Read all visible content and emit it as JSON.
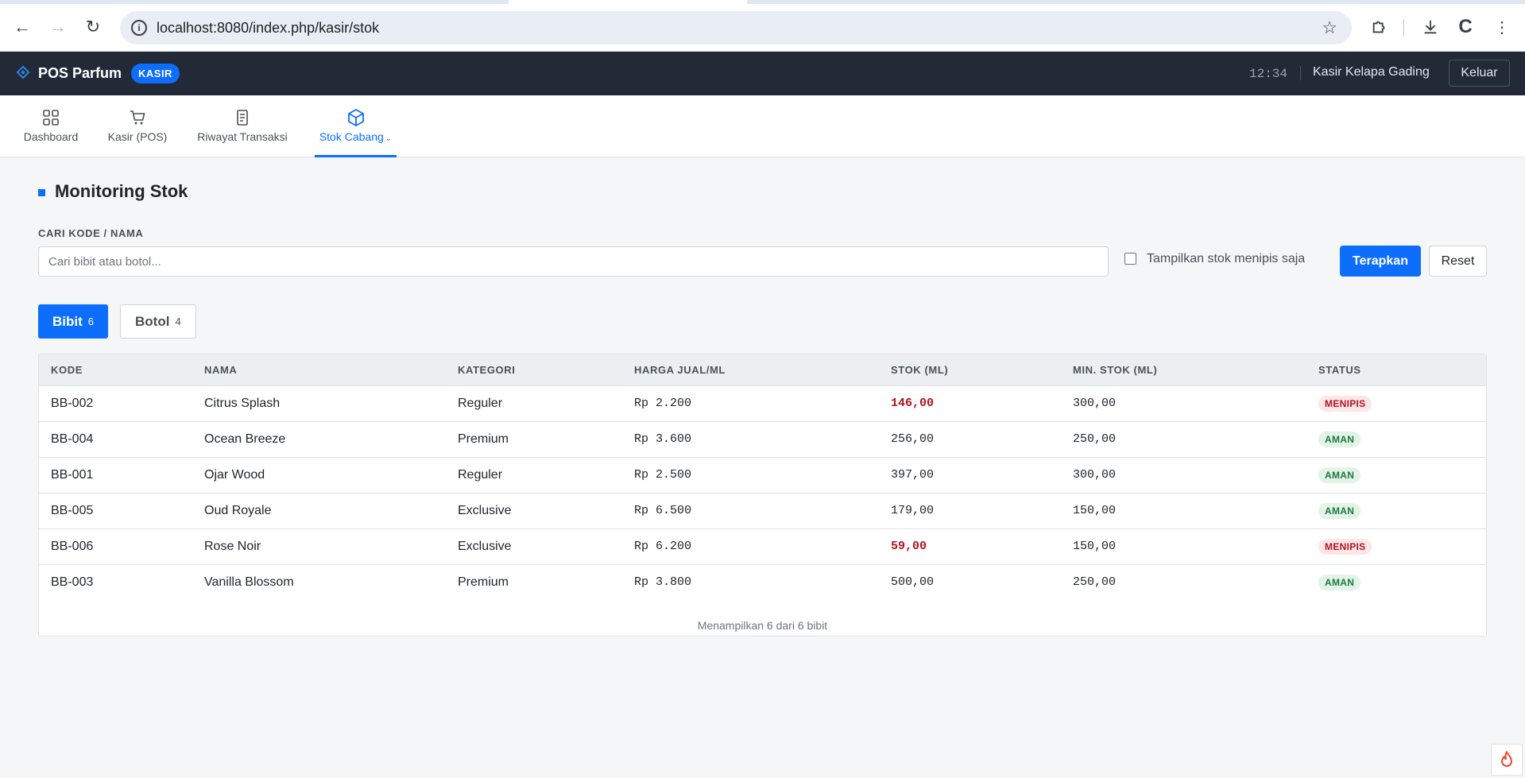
{
  "browser": {
    "url": "localhost:8080/index.php/kasir/stok"
  },
  "header": {
    "brand": "POS Parfum",
    "role_badge": "KASIR",
    "clock": "12:34",
    "user": "Kasir Kelapa Gading",
    "logout_label": "Keluar"
  },
  "nav": {
    "items": [
      {
        "label": "Dashboard",
        "icon": "grid-icon"
      },
      {
        "label": "Kasir (POS)",
        "icon": "cart-icon"
      },
      {
        "label": "Riwayat Transaksi",
        "icon": "receipt-icon"
      },
      {
        "label": "Stok Cabang",
        "icon": "box-icon",
        "active": true
      }
    ]
  },
  "main": {
    "title": "Monitoring Stok",
    "search_label": "CARI KODE / NAMA",
    "search_placeholder": "Cari bibit atau botol...",
    "search_value": "",
    "low_stock_label": "Tampilkan stok menipis saja",
    "low_stock_checked": false,
    "apply_label": "Terapkan",
    "reset_label": "Reset",
    "tabs": [
      {
        "label": "Bibit",
        "count": "6",
        "active": true
      },
      {
        "label": "Botol",
        "count": "4",
        "active": false
      }
    ]
  },
  "table": {
    "columns": [
      "KODE",
      "NAMA",
      "KATEGORI",
      "HARGA JUAL/ML",
      "STOK (ML)",
      "MIN. STOK (ML)",
      "STATUS"
    ],
    "rows": [
      {
        "kode": "BB-002",
        "nama": "Citrus Splash",
        "kategori": "Reguler",
        "harga": "Rp 2.200",
        "stok": "146,00",
        "min": "300,00",
        "status": "MENIPIS",
        "low": true
      },
      {
        "kode": "BB-004",
        "nama": "Ocean Breeze",
        "kategori": "Premium",
        "harga": "Rp 3.600",
        "stok": "256,00",
        "min": "250,00",
        "status": "AMAN",
        "low": false
      },
      {
        "kode": "BB-001",
        "nama": "Ojar Wood",
        "kategori": "Reguler",
        "harga": "Rp 2.500",
        "stok": "397,00",
        "min": "300,00",
        "status": "AMAN",
        "low": false
      },
      {
        "kode": "BB-005",
        "nama": "Oud Royale",
        "kategori": "Exclusive",
        "harga": "Rp 6.500",
        "stok": "179,00",
        "min": "150,00",
        "status": "AMAN",
        "low": false
      },
      {
        "kode": "BB-006",
        "nama": "Rose Noir",
        "kategori": "Exclusive",
        "harga": "Rp 6.200",
        "stok": "59,00",
        "min": "150,00",
        "status": "MENIPIS",
        "low": true
      },
      {
        "kode": "BB-003",
        "nama": "Vanilla Blossom",
        "kategori": "Premium",
        "harga": "Rp 3.800",
        "stok": "500,00",
        "min": "250,00",
        "status": "AMAN",
        "low": false
      }
    ],
    "footer": "Menampilkan 6 dari 6 bibit"
  },
  "colors": {
    "accent": "#0d6efd",
    "header_bg": "#212a36",
    "low": "#b3131f",
    "ok": "#1b7a3d"
  }
}
